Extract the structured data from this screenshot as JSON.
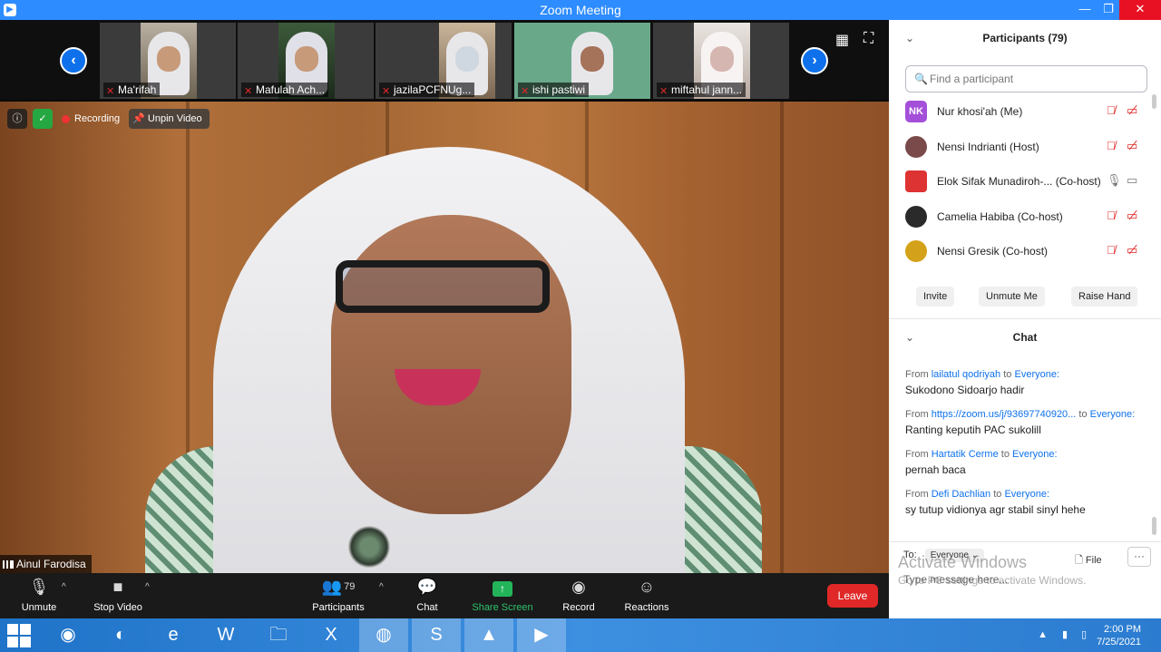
{
  "window": {
    "title": "Zoom Meeting"
  },
  "thumbnails": [
    {
      "name": "Ma'rifah"
    },
    {
      "name": "Mafulah Ach..."
    },
    {
      "name": "jazilaPCFNUg..."
    },
    {
      "name": "ishi pastiwi"
    },
    {
      "name": "miftahul jann..."
    }
  ],
  "main_video": {
    "recording_label": "Recording",
    "unpin_label": "Unpin Video",
    "speaker_name": "Ainul Farodisa"
  },
  "toolbar": {
    "unmute": "Unmute",
    "stop_video": "Stop Video",
    "participants": "Participants",
    "participants_count": "79",
    "chat": "Chat",
    "share_screen": "Share Screen",
    "record": "Record",
    "reactions": "Reactions",
    "leave": "Leave"
  },
  "participants_panel": {
    "title": "Participants (79)",
    "search_placeholder": "Find a participant",
    "list": [
      {
        "initials": "NK",
        "name": "Nur khosi'ah (Me)"
      },
      {
        "initials": "",
        "name": "Nensi Indrianti (Host)"
      },
      {
        "initials": "",
        "name": "Elok Sifak Munadiroh-... (Co-host)"
      },
      {
        "initials": "",
        "name": "Camelia Habiba (Co-host)"
      },
      {
        "initials": "",
        "name": "Nensi Gresik (Co-host)"
      }
    ],
    "buttons": {
      "invite": "Invite",
      "unmute_me": "Unmute Me",
      "raise_hand": "Raise Hand"
    }
  },
  "chat_panel": {
    "title": "Chat",
    "from_word": "From",
    "to_word": "to",
    "messages": [
      {
        "sender": "lailatul qodriyah",
        "recipient": "Everyone:",
        "text": "Sukodono Sidoarjo hadir"
      },
      {
        "sender": "https://zoom.us/j/93697740920...",
        "recipient": "Everyone:",
        "text": "Ranting keputih  PAC sukolill"
      },
      {
        "sender": "Hartatik Cerme",
        "recipient": "Everyone:",
        "text": "pernah baca"
      },
      {
        "sender": "Defi Dachlian",
        "recipient": "Everyone:",
        "text": "sy tutup vidionya agr stabil sinyl hehe"
      }
    ],
    "to_label": "To:",
    "to_value": "Everyone",
    "file_label": "File",
    "input_placeholder": "Type message here..."
  },
  "watermark": {
    "line1": "Activate Windows",
    "line2": "Go to PC settings to activate Windows."
  },
  "taskbar": {
    "time": "2:00 PM",
    "date": "7/25/2021"
  },
  "colors": {
    "zoom_blue": "#2d8cff",
    "leave_red": "#e02828",
    "share_green": "#23b45a",
    "link_blue": "#0e71eb"
  }
}
